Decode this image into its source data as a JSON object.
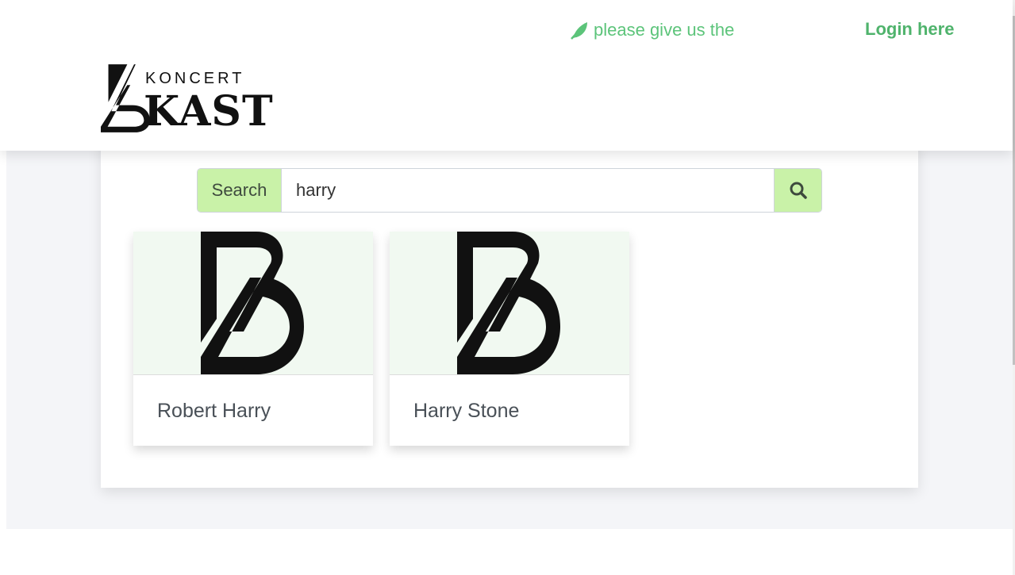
{
  "header": {
    "announcement": "please give us the",
    "announcement_icon": "leaf-icon",
    "login_label": "Login here",
    "accent_color": "#5cc47a"
  },
  "logo": {
    "top_word": "KONCERT",
    "main_word": "KAST"
  },
  "search": {
    "label": "Search",
    "value": "harry",
    "button_icon": "search-icon"
  },
  "results": [
    {
      "name": "Robert Harry"
    },
    {
      "name": "Harry Stone"
    }
  ]
}
